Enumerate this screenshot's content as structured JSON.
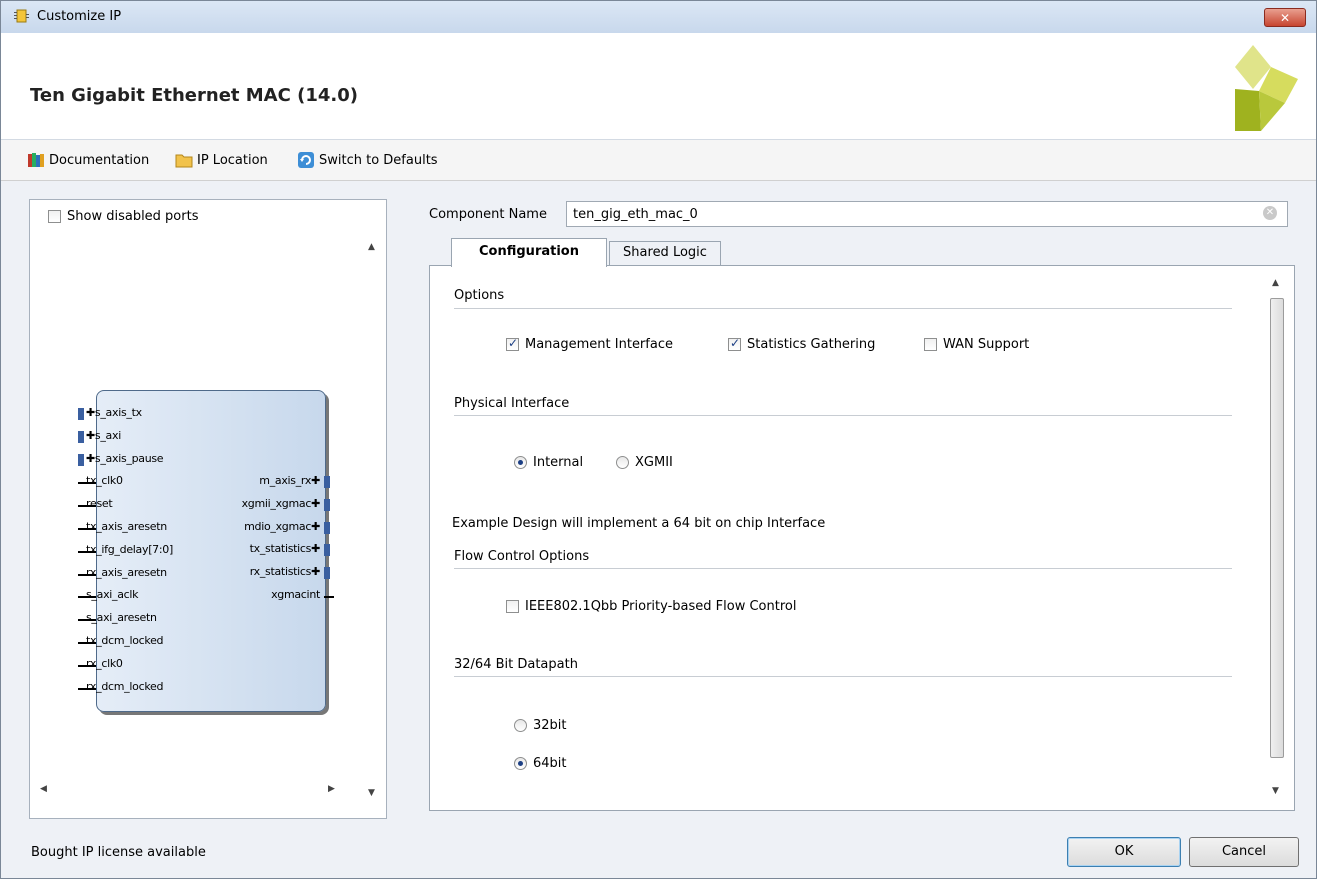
{
  "window": {
    "title": "Customize IP",
    "close_label": "✕"
  },
  "header": {
    "title": "Ten Gigabit Ethernet MAC (14.0)",
    "logo_icon": "xilinx-logo-icon"
  },
  "toolbar": {
    "documentation": "Documentation",
    "ip_location": "IP Location",
    "switch_defaults": "Switch to Defaults"
  },
  "left_panel": {
    "show_disabled_ports": "Show disabled ports",
    "show_disabled_checked": false,
    "left_ports": [
      {
        "name": "s_axis_tx",
        "bus": true
      },
      {
        "name": "s_axi",
        "bus": true
      },
      {
        "name": "s_axis_pause",
        "bus": true
      },
      {
        "name": "tx_clk0",
        "bus": false
      },
      {
        "name": "reset",
        "bus": false
      },
      {
        "name": "tx_axis_aresetn",
        "bus": false
      },
      {
        "name": "tx_ifg_delay[7:0]",
        "bus": false
      },
      {
        "name": "rx_axis_aresetn",
        "bus": false
      },
      {
        "name": "s_axi_aclk",
        "bus": false
      },
      {
        "name": "s_axi_aresetn",
        "bus": false
      },
      {
        "name": "tx_dcm_locked",
        "bus": false
      },
      {
        "name": "rx_clk0",
        "bus": false
      },
      {
        "name": "rx_dcm_locked",
        "bus": false
      }
    ],
    "right_ports": [
      {
        "name": "m_axis_rx",
        "bus": true
      },
      {
        "name": "xgmii_xgmac",
        "bus": true
      },
      {
        "name": "mdio_xgmac",
        "bus": true
      },
      {
        "name": "tx_statistics",
        "bus": true
      },
      {
        "name": "rx_statistics",
        "bus": true
      },
      {
        "name": "xgmacint",
        "bus": false
      }
    ]
  },
  "component": {
    "label": "Component Name",
    "value": "ten_gig_eth_mac_0"
  },
  "tabs": [
    {
      "label": "Configuration",
      "active": true
    },
    {
      "label": "Shared Logic",
      "active": false
    }
  ],
  "config": {
    "options": {
      "title": "Options",
      "management_interface": "Management Interface",
      "statistics_gathering": "Statistics Gathering",
      "wan_support": "WAN Support"
    },
    "physical": {
      "title": "Physical Interface",
      "internal": "Internal",
      "xgmii": "XGMII",
      "selected": "Internal"
    },
    "example_note": "Example Design will implement a 64 bit on chip Interface",
    "flow": {
      "title": "Flow Control Options",
      "pfc": "IEEE802.1Qbb Priority-based Flow Control"
    },
    "datapath": {
      "title": "32/64 Bit Datapath",
      "opt32": "32bit",
      "opt64": "64bit",
      "selected": "64bit"
    }
  },
  "footer": {
    "status": "Bought IP license available",
    "ok": "OK",
    "cancel": "Cancel"
  }
}
